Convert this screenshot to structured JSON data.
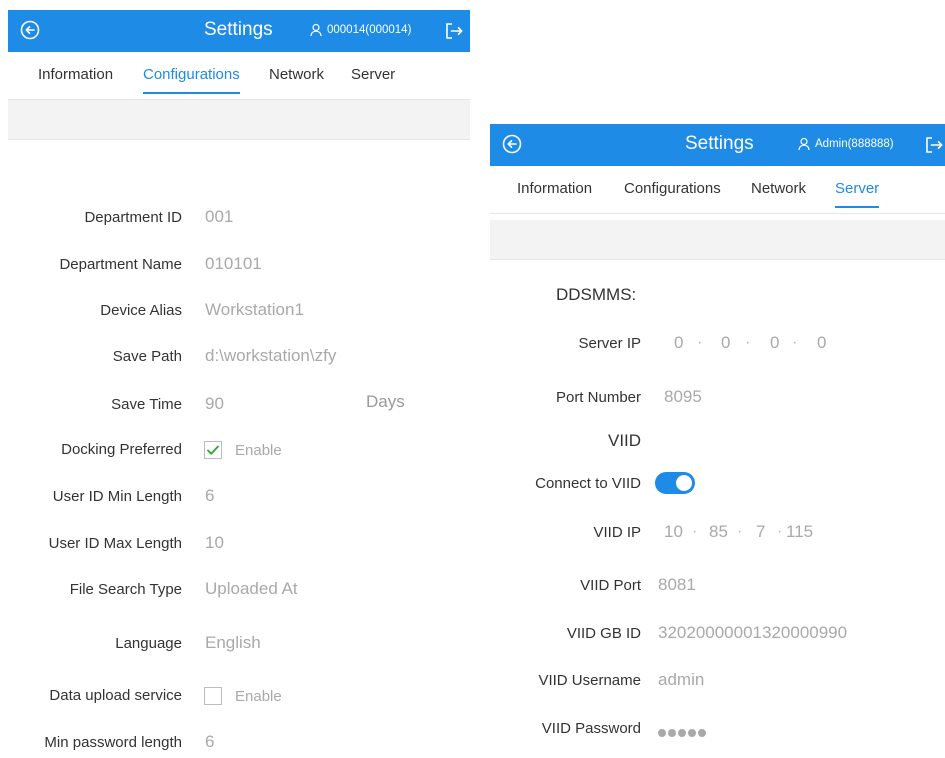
{
  "left": {
    "title": "Settings",
    "user": "000014(000014)",
    "tabs": [
      "Information",
      "Configurations",
      "Network",
      "Server"
    ],
    "active_tab": "Configurations",
    "fields": {
      "department_id": {
        "label": "Department ID",
        "value": "001"
      },
      "department_name": {
        "label": "Department Name",
        "value": "010101"
      },
      "device_alias": {
        "label": "Device Alias",
        "value": "Workstation1"
      },
      "save_path": {
        "label": "Save Path",
        "value": "d:\\workstation\\zfy"
      },
      "save_time": {
        "label": "Save Time",
        "value": "90",
        "unit": "Days"
      },
      "docking_preferred": {
        "label": "Docking Preferred",
        "checked": true,
        "option": "Enable"
      },
      "user_id_min": {
        "label": "User ID Min Length",
        "value": "6"
      },
      "user_id_max": {
        "label": "User ID Max Length",
        "value": "10"
      },
      "file_search_type": {
        "label": "File Search Type",
        "value": "Uploaded At"
      },
      "language": {
        "label": "Language",
        "value": "English"
      },
      "data_upload": {
        "label": "Data upload service",
        "checked": false,
        "option": "Enable"
      },
      "min_password": {
        "label": "Min password length",
        "value": "6"
      }
    }
  },
  "right": {
    "title": "Settings",
    "user": "Admin(888888)",
    "tabs": [
      "Information",
      "Configurations",
      "Network",
      "Server"
    ],
    "active_tab": "Server",
    "ddsmms_heading": "DDSMMS:",
    "server_ip": {
      "label": "Server IP",
      "octets": [
        "0",
        "0",
        "0",
        "0"
      ]
    },
    "port_number": {
      "label": "Port Number",
      "value": "8095"
    },
    "viid_heading": "VIID",
    "connect_viid": {
      "label": "Connect to VIID",
      "on": true
    },
    "viid_ip": {
      "label": "VIID IP",
      "octets": [
        "10",
        "85",
        "7",
        "115"
      ]
    },
    "viid_port": {
      "label": "VIID Port",
      "value": "8081"
    },
    "viid_gb_id": {
      "label": "VIID GB ID",
      "value": "32020000001320000990"
    },
    "viid_username": {
      "label": "VIID Username",
      "value": "admin"
    },
    "viid_password": {
      "label": "VIID Password",
      "masked_length": 5
    }
  },
  "colors": {
    "accent": "#1e8be6",
    "value_text": "#a9a9a9",
    "band": "#f3f3f3"
  },
  "icons": [
    "back-circle-icon",
    "user-icon",
    "logout-icon",
    "checkmark-icon"
  ]
}
